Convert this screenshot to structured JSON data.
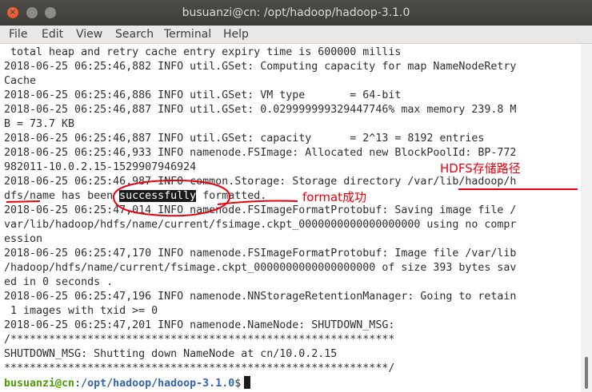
{
  "window": {
    "title": "busuanzi@cn: /opt/hadoop/hadoop-3.1.0",
    "close_glyph": "×"
  },
  "menu": [
    "File",
    "Edit",
    "View",
    "Search",
    "Terminal",
    "Help"
  ],
  "terminal": {
    "lines": [
      " total heap and retry cache entry expiry time is 600000 millis",
      "2018-06-25 06:25:46,882 INFO util.GSet: Computing capacity for map NameNodeRetry",
      "Cache",
      "2018-06-25 06:25:46,886 INFO util.GSet: VM type       = 64-bit",
      "2018-06-25 06:25:46,887 INFO util.GSet: 0.029999999329447746% max memory 239.8 M",
      "B = 73.7 KB",
      "2018-06-25 06:25:46,887 INFO util.GSet: capacity      = 2^13 = 8192 entries",
      "2018-06-25 06:25:46,933 INFO namenode.FSImage: Allocated new BlockPoolId: BP-772",
      "982011-10.0.2.15-1529907946924",
      "2018-06-25 06:25:46,987 INFO common.Storage: Storage directory /var/lib/hadoop/h",
      "dfs/name has been ",
      "2018-06-25 06:25:47,014 INFO namenode.FSImageFormatProtobuf: Saving image file /",
      "var/lib/hadoop/hdfs/name/current/fsimage.ckpt_0000000000000000000 using no compr",
      "ession",
      "2018-06-25 06:25:47,170 INFO namenode.FSImageFormatProtobuf: Image file /var/lib",
      "/hadoop/hdfs/name/current/fsimage.ckpt_0000000000000000000 of size 393 bytes sav",
      "ed in 0 seconds .",
      "2018-06-25 06:25:47,196 INFO namenode.NNStorageRetentionManager: Going to retain",
      " 1 images with txid >= 0",
      "2018-06-25 06:25:47,201 INFO namenode.NameNode: SHUTDOWN_MSG:",
      "/************************************************************",
      "SHUTDOWN_MSG: Shutting down NameNode at cn/10.0.2.15",
      "************************************************************/"
    ],
    "selected_word": "successfully",
    "after_selected": " formatted.",
    "prompt_user": "busuanzi@cn",
    "prompt_sep": ":",
    "prompt_path": "/opt/hadoop/hadoop-3.1.0",
    "prompt_symbol": "$"
  },
  "annotations": {
    "hdfs_path_note": "HDFS存储路径",
    "format_note": "format成功",
    "color": "#e8000b"
  }
}
